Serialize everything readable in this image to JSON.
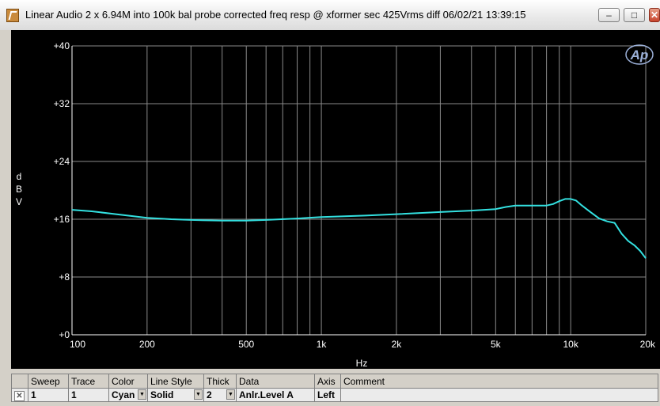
{
  "window": {
    "title": "Linear Audio  2 x 6.94M into 100k bal probe corrected freq resp @ xformer sec 425Vrms diff  06/02/21 13:39:15",
    "minimize": "‒",
    "maximize": "□",
    "close": "✕"
  },
  "logo": "Ap",
  "chart_data": {
    "type": "line",
    "xscale": "log",
    "xlabel": "Hz",
    "ylabel_chars": [
      "d",
      "B",
      "V"
    ],
    "xlim": [
      100,
      20000
    ],
    "ylim": [
      0,
      40
    ],
    "xticks": [
      {
        "v": 100,
        "label": "100"
      },
      {
        "v": 200,
        "label": "200"
      },
      {
        "v": 500,
        "label": "500"
      },
      {
        "v": 1000,
        "label": "1k"
      },
      {
        "v": 2000,
        "label": "2k"
      },
      {
        "v": 5000,
        "label": "5k"
      },
      {
        "v": 10000,
        "label": "10k"
      },
      {
        "v": 20000,
        "label": "20k"
      }
    ],
    "yticks": [
      {
        "v": 0,
        "label": "+0"
      },
      {
        "v": 8,
        "label": "+8"
      },
      {
        "v": 16,
        "label": "+16"
      },
      {
        "v": 24,
        "label": "+24"
      },
      {
        "v": 32,
        "label": "+32"
      },
      {
        "v": 40,
        "label": "+40"
      }
    ],
    "grid": true,
    "series": [
      {
        "color": "#33e0e0",
        "x": [
          100,
          120,
          150,
          200,
          250,
          300,
          400,
          500,
          600,
          800,
          1000,
          1500,
          2000,
          3000,
          4000,
          5000,
          5500,
          6000,
          7000,
          8000,
          8500,
          9000,
          9500,
          10000,
          10500,
          11000,
          12000,
          13000,
          14000,
          15000,
          16000,
          17000,
          18000,
          19000,
          20000
        ],
        "y": [
          17.3,
          17.1,
          16.7,
          16.2,
          16.0,
          15.9,
          15.8,
          15.8,
          15.9,
          16.1,
          16.3,
          16.5,
          16.7,
          17.0,
          17.2,
          17.4,
          17.7,
          17.9,
          17.9,
          17.9,
          18.1,
          18.5,
          18.8,
          18.8,
          18.6,
          18.0,
          17.0,
          16.1,
          15.7,
          15.5,
          14.0,
          13.0,
          12.4,
          11.6,
          10.6
        ]
      }
    ]
  },
  "legend": {
    "headers": [
      "Sweep",
      "Trace",
      "Color",
      "Line Style",
      "Thick",
      "Data",
      "Axis",
      "Comment"
    ],
    "row": {
      "checkbox": "✕",
      "sweep": "1",
      "trace": "1",
      "color": "Cyan",
      "line_style": "Solid",
      "thick": "2",
      "data": "Anlr.Level A",
      "axis": "Left",
      "comment": ""
    }
  }
}
